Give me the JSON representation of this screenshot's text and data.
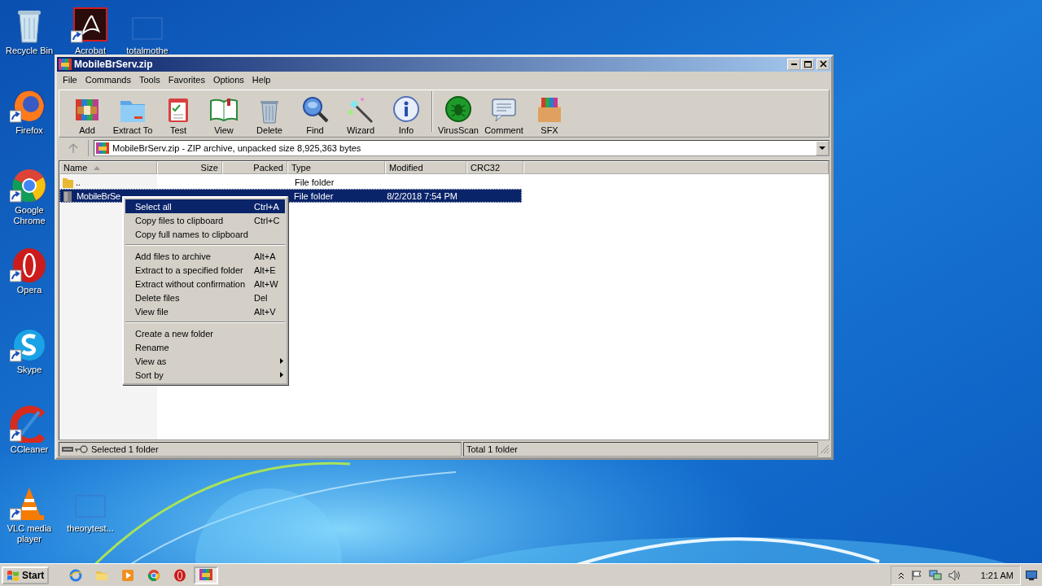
{
  "desktop": {
    "icons": [
      {
        "label": "Recycle Bin",
        "shortcut": false
      },
      {
        "label": "Acrobat",
        "shortcut": true
      },
      {
        "label": "totalmothe",
        "shortcut": false
      },
      {
        "label": "Firefox",
        "shortcut": true
      },
      {
        "label": "Google Chrome",
        "shortcut": true
      },
      {
        "label": "Opera",
        "shortcut": true
      },
      {
        "label": "Skype",
        "shortcut": true
      },
      {
        "label": "CCleaner",
        "shortcut": true
      },
      {
        "label": "VLC media player",
        "shortcut": true
      },
      {
        "label": "theorytest...",
        "shortcut": false
      }
    ]
  },
  "window": {
    "title": "MobileBrServ.zip",
    "menu": [
      "File",
      "Commands",
      "Tools",
      "Favorites",
      "Options",
      "Help"
    ],
    "toolbar": [
      {
        "kind": "button",
        "label": "Add"
      },
      {
        "kind": "button",
        "label": "Extract To"
      },
      {
        "kind": "button",
        "label": "Test"
      },
      {
        "kind": "button",
        "label": "View"
      },
      {
        "kind": "button",
        "label": "Delete"
      },
      {
        "kind": "button",
        "label": "Find"
      },
      {
        "kind": "button",
        "label": "Wizard"
      },
      {
        "kind": "button",
        "label": "Info"
      },
      {
        "kind": "separator"
      },
      {
        "kind": "button",
        "label": "VirusScan"
      },
      {
        "kind": "button",
        "label": "Comment"
      },
      {
        "kind": "button",
        "label": "SFX"
      }
    ],
    "address": "MobileBrServ.zip - ZIP archive, unpacked size 8,925,363 bytes",
    "columns": [
      {
        "label": "Name",
        "sorted": true
      },
      {
        "label": "Size",
        "sorted": false
      },
      {
        "label": "Packed",
        "sorted": false
      },
      {
        "label": "Type",
        "sorted": false
      },
      {
        "label": "Modified",
        "sorted": false
      },
      {
        "label": "CRC32",
        "sorted": false
      }
    ],
    "rows": [
      {
        "kind": "up",
        "name": "..",
        "type": "File folder",
        "selected": false
      },
      {
        "kind": "folder",
        "name": "MobileBrSe",
        "type": "File folder",
        "modified": "8/2/2018 7:54 PM",
        "selected": true
      }
    ],
    "status_bar": {
      "left": "Selected 1 folder",
      "right": "Total 1 folder"
    }
  },
  "context_menu": {
    "items": [
      {
        "kind": "item",
        "label": "Select all",
        "shortcut": "Ctrl+A",
        "submenu": false,
        "selected": true
      },
      {
        "kind": "item",
        "label": "Copy files to clipboard",
        "shortcut": "Ctrl+C",
        "submenu": false,
        "selected": false
      },
      {
        "kind": "item",
        "label": "Copy full names to clipboard",
        "submenu": false,
        "selected": false
      },
      {
        "kind": "separator"
      },
      {
        "kind": "item",
        "label": "Add files to archive",
        "shortcut": "Alt+A",
        "submenu": false,
        "selected": false
      },
      {
        "kind": "item",
        "label": "Extract to a specified folder",
        "shortcut": "Alt+E",
        "submenu": false,
        "selected": false
      },
      {
        "kind": "item",
        "label": "Extract without confirmation",
        "shortcut": "Alt+W",
        "submenu": false,
        "selected": false
      },
      {
        "kind": "item",
        "label": "Delete files",
        "shortcut": "Del",
        "submenu": false,
        "selected": false
      },
      {
        "kind": "item",
        "label": "View file",
        "shortcut": "Alt+V",
        "submenu": false,
        "selected": false
      },
      {
        "kind": "separator"
      },
      {
        "kind": "item",
        "label": "Create a new folder",
        "submenu": false,
        "selected": false
      },
      {
        "kind": "item",
        "label": "Rename",
        "submenu": false,
        "selected": false
      },
      {
        "kind": "item",
        "label": "View as",
        "submenu": true,
        "selected": false
      },
      {
        "kind": "item",
        "label": "Sort by",
        "submenu": true,
        "selected": false
      }
    ]
  },
  "taskbar": {
    "start": "Start",
    "apps": [
      {
        "active": false
      },
      {
        "active": false
      },
      {
        "active": false
      },
      {
        "active": false
      },
      {
        "active": false
      },
      {
        "active": true
      }
    ],
    "clock": "1:21 AM"
  }
}
